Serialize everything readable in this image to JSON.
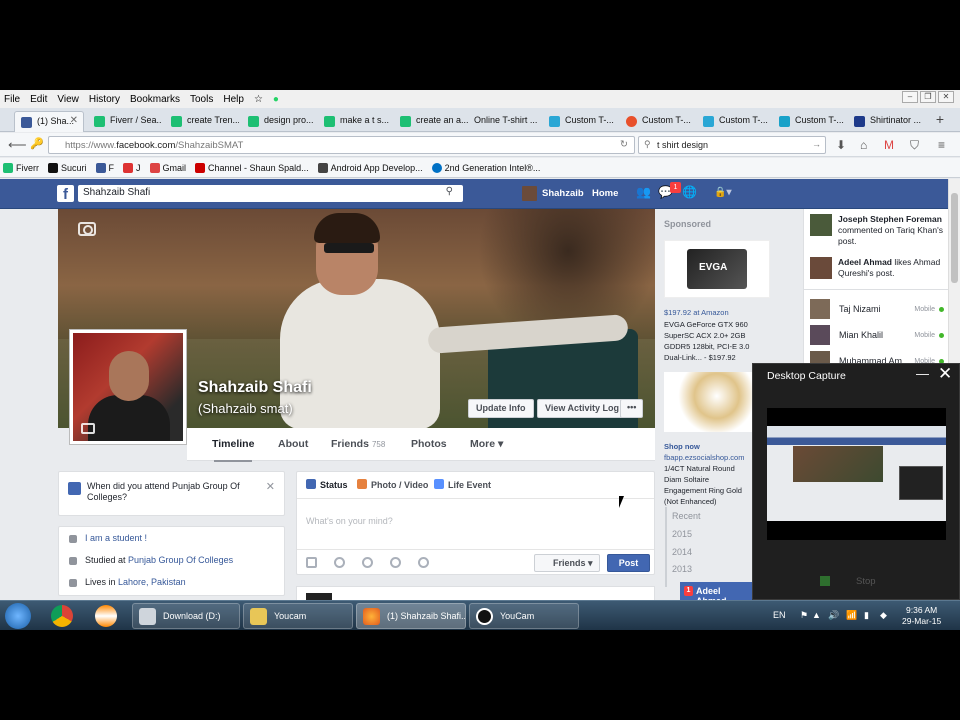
{
  "menubar": {
    "items": [
      "File",
      "Edit",
      "View",
      "History",
      "Bookmarks",
      "Tools",
      "Help"
    ]
  },
  "tabs": [
    {
      "label": "(1) Sha...",
      "icon": "facebook-icon",
      "color": "#3b5998",
      "active": true
    },
    {
      "label": "Fiverr / Sea...",
      "icon": "fiverr-icon",
      "color": "#1dbf73"
    },
    {
      "label": "create Tren...",
      "icon": "fiverr-icon",
      "color": "#1dbf73"
    },
    {
      "label": "design pro...",
      "icon": "fiverr-icon",
      "color": "#1dbf73"
    },
    {
      "label": "make a t s...",
      "icon": "fiverr-icon",
      "color": "#1dbf73"
    },
    {
      "label": "create an a...",
      "icon": "fiverr-icon",
      "color": "#1dbf73"
    },
    {
      "label": "Online T-shirt ...",
      "icon": "none",
      "color": "transparent"
    },
    {
      "label": "Custom T-...",
      "icon": "tshirt-icon",
      "color": "#2aa7d5"
    },
    {
      "label": "Custom T-...",
      "icon": "heart-icon",
      "color": "#e8502b"
    },
    {
      "label": "Custom T-...",
      "icon": "tshirt-icon",
      "color": "#2aa7d5"
    },
    {
      "label": "Custom T-...",
      "icon": "refresh-icon",
      "color": "#19a2c9"
    },
    {
      "label": "Shirtinator ...",
      "icon": "shirtinator-icon",
      "color": "#1e3a8a"
    }
  ],
  "nav": {
    "url_prefix": "https://www.",
    "url_host": "facebook.com",
    "url_path": "/ShahzaibSMAT",
    "search_value": "t shirt design"
  },
  "bookmarks": [
    {
      "label": "Fiverr",
      "color": "#1dbf73"
    },
    {
      "label": "Sucuri",
      "color": "#111"
    },
    {
      "label": "F",
      "color": "#3b5998"
    },
    {
      "label": "J",
      "color": "#d33"
    },
    {
      "label": "Gmail",
      "color": "#d44"
    },
    {
      "label": "Channel - Shaun Spald...",
      "color": "#c00"
    },
    {
      "label": "Android App Develop...",
      "color": "#444"
    },
    {
      "label": "2nd Generation Intel®...",
      "color": "#0071c5"
    }
  ],
  "fb": {
    "search_value": "Shahzaib Shafi",
    "user_name": "Shahzaib",
    "home_label": "Home",
    "notif_count": "1",
    "profile_name": "Shahzaib Shafi",
    "alt_name": "(Shahzaib smat)",
    "update_info": "Update Info",
    "activity_log": "View Activity Log",
    "more_dots": "•••",
    "profile_nav": [
      {
        "label": "Timeline"
      },
      {
        "label": "About"
      },
      {
        "label": "Friends",
        "count": "758"
      },
      {
        "label": "Photos"
      },
      {
        "label": "More ▾"
      }
    ],
    "question": "When did you attend Punjab Group Of Colleges?",
    "intro": {
      "student": "I am a student !",
      "studied_prefix": "Studied at ",
      "studied_link": "Punjab Group Of Colleges",
      "lives_prefix": "Lives in ",
      "lives_link": "Lahore, Pakistan"
    },
    "composer": {
      "tabs": [
        "Status",
        "Photo / Video",
        "Life Event"
      ],
      "placeholder": "What's on your mind?",
      "audience": "Friends ▾",
      "post": "Post"
    },
    "years": [
      "Recent",
      "2015",
      "2014",
      "2013"
    ],
    "sponsored": "Sponsored",
    "ad1": {
      "brand": "EVGA",
      "price": "$197.92 at Amazon",
      "desc": "EVGA GeForce GTX 960 SuperSC ACX 2.0+ 2GB GDDR5 128bit, PCI-E 3.0 Dual-Link... - $197.92"
    },
    "ad2": {
      "title": "Shop now",
      "url": "fbapp.ezsocialshop.com",
      "desc": "1/4CT Natural Round Diam Soltaire Engagement Ring Gold (Not Enhanced)"
    },
    "ticker": [
      {
        "name": "Joseph Stephen Foreman",
        "text": " commented on Tariq Khan's post."
      },
      {
        "name": "Adeel Ahmad",
        "text": " likes Ahmad Qureshi's post."
      }
    ],
    "chat": [
      {
        "name": "Taj Nizami",
        "status": "Mobile"
      },
      {
        "name": "Mian Khalil",
        "status": "Mobile"
      },
      {
        "name": "Muhammad Am...",
        "status": "Mobile"
      }
    ],
    "chat_tab": {
      "badge": "1",
      "name": "Adeel Ahmad"
    }
  },
  "capture": {
    "title": "Desktop Capture",
    "min": "—",
    "close": "✕",
    "stop": "Stop"
  },
  "taskbar": {
    "items": [
      {
        "label": "Download (D:)"
      },
      {
        "label": "Youcam"
      },
      {
        "label": "(1) Shahzaib Shafi..."
      },
      {
        "label": "YouCam"
      }
    ],
    "lang": "EN",
    "time": "9:36 AM",
    "date": "29-Mar-15"
  }
}
